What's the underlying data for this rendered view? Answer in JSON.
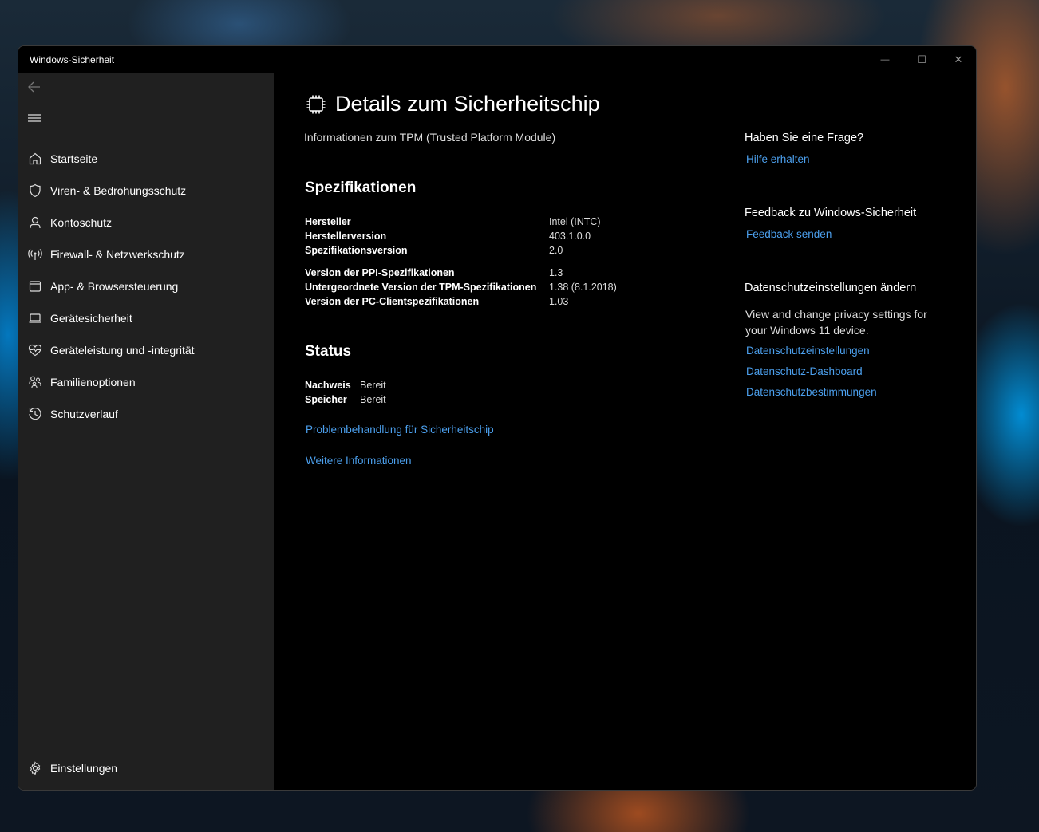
{
  "window": {
    "title": "Windows-Sicherheit",
    "controls": {
      "minimize": "—",
      "maximize": "☐",
      "close": "✕"
    }
  },
  "sidebar": {
    "back_icon": "back-arrow-icon",
    "menu_icon": "hamburger-menu-icon",
    "items": [
      {
        "label": "Startseite",
        "icon": "home-icon"
      },
      {
        "label": "Viren- & Bedrohungsschutz",
        "icon": "shield-icon"
      },
      {
        "label": "Kontoschutz",
        "icon": "person-icon"
      },
      {
        "label": "Firewall- & Netzwerkschutz",
        "icon": "antenna-icon"
      },
      {
        "label": "App- & Browsersteuerung",
        "icon": "app-window-icon"
      },
      {
        "label": "Gerätesicherheit",
        "icon": "laptop-icon"
      },
      {
        "label": "Geräteleistung und -integrität",
        "icon": "heart-pulse-icon"
      },
      {
        "label": "Familienoptionen",
        "icon": "family-icon"
      },
      {
        "label": "Schutzverlauf",
        "icon": "history-icon"
      }
    ],
    "settings": {
      "label": "Einstellungen",
      "icon": "gear-icon"
    }
  },
  "main": {
    "title": "Details zum Sicherheitschip",
    "title_icon": "chip-icon",
    "subtitle": "Informationen zum TPM (Trusted Platform Module)",
    "specs_heading": "Spezifikationen",
    "specs": [
      {
        "label": "Hersteller",
        "value": "Intel (INTC)"
      },
      {
        "label": "Herstellerversion",
        "value": "403.1.0.0"
      },
      {
        "label": "Spezifikationsversion",
        "value": "2.0"
      },
      {
        "label": "Version der PPI-Spezifikationen",
        "value": "1.3"
      },
      {
        "label": "Untergeordnete Version der TPM-Spezifikationen",
        "value": "1.38 (8.1.2018)"
      },
      {
        "label": "Version der PC-Clientspezifikationen",
        "value": "1.03"
      }
    ],
    "status_heading": "Status",
    "status": [
      {
        "label": "Nachweis",
        "value": "Bereit"
      },
      {
        "label": "Speicher",
        "value": "Bereit"
      }
    ],
    "links": {
      "troubleshoot": "Problembehandlung für Sicherheitschip",
      "more_info": "Weitere Informationen"
    }
  },
  "aside": {
    "question_heading": "Haben Sie eine Frage?",
    "help_link": "Hilfe erhalten",
    "feedback_heading": "Feedback zu Windows-Sicherheit",
    "feedback_link": "Feedback senden",
    "privacy_heading": "Datenschutzeinstellungen ändern",
    "privacy_text": "View and change privacy settings for your Windows 11 device.",
    "privacy_links": [
      "Datenschutzeinstellungen",
      "Datenschutz-Dashboard",
      "Datenschutzbestimmungen"
    ]
  },
  "colors": {
    "link": "#4ca0ee",
    "sidebar_bg": "#202020",
    "content_bg": "#000000"
  }
}
